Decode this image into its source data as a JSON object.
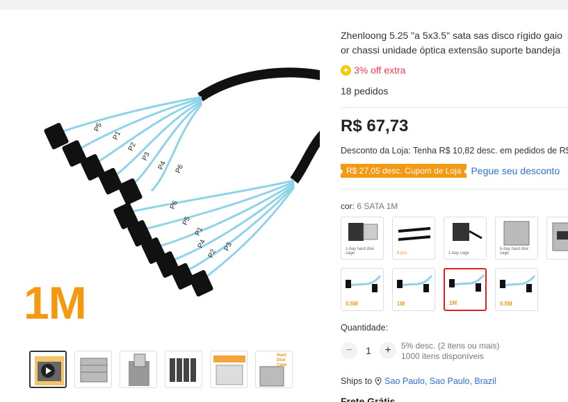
{
  "product": {
    "title_line1": "Zhenloong 5.25 \"a 5x3.5\" sata sas disco rígido gaio",
    "title_line2": "or chassi unidade óptica extensão suporte bandeja",
    "extra_discount": "3% off extra",
    "orders": "18 pedidos",
    "price": "R$ 67,73",
    "store_discount": "Desconto da Loja: Tenha R$ 10,82 desc. em pedidos de R$",
    "coupon": "R$ 27,05 desc. Cupom de Loja",
    "get_coupon": "Pegue seu desconto"
  },
  "main_image": {
    "label": "1M",
    "cable_labels_top": [
      "P5",
      "P1",
      "P2",
      "P3",
      "P4",
      "P6"
    ],
    "cable_labels_bottom": [
      "P6",
      "P5",
      "P1",
      "P4",
      "P2",
      "P3"
    ]
  },
  "variant": {
    "label": "cor:",
    "selected": "6 SATA 1M",
    "options": [
      {
        "caption": "1-bay hard disk cage"
      },
      {
        "caption": "6 pcs"
      },
      {
        "caption": "1-bay cage"
      },
      {
        "caption": "5-bay hard disk cage"
      },
      {
        "caption": ""
      },
      {
        "caption": "0.5M"
      },
      {
        "caption": "1M"
      },
      {
        "caption": "1M"
      },
      {
        "caption": "0.5M"
      }
    ]
  },
  "thumbnails": {
    "last_caption": "Hard Disk Cage"
  },
  "quantity": {
    "label": "Quantidade:",
    "value": "1",
    "minus": "−",
    "plus": "+",
    "info_line1": "5% desc. (2 itens ou mais)",
    "info_line2": "1000 itens disponíveis"
  },
  "shipping": {
    "label": "Ships to",
    "location": "Sao Paulo, Sao Paulo, Brazil",
    "frete": "Frete Grátis"
  },
  "colors": {
    "accent_orange": "#f39a12",
    "price_red": "#fd384f",
    "link_blue": "#2e6fd6",
    "cable_blue": "#8fd3ea"
  }
}
